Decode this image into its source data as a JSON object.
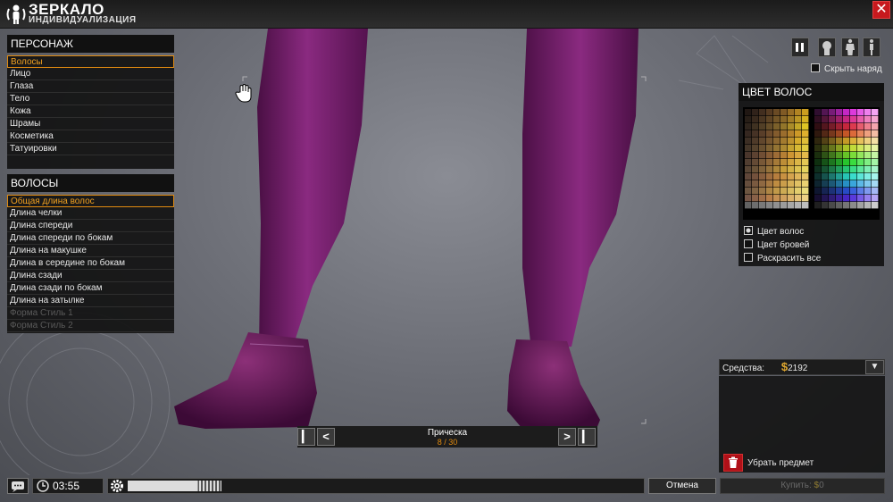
{
  "header": {
    "title": "ЗЕРКАЛО",
    "subtitle": "ИНДИВИДУАЛИЗАЦИЯ",
    "close_icon": "close-icon"
  },
  "character_panel": {
    "title": "ПЕРСОНАЖ",
    "items": [
      {
        "label": "Волосы",
        "selected": true
      },
      {
        "label": "Лицо"
      },
      {
        "label": "Глаза"
      },
      {
        "label": "Тело"
      },
      {
        "label": "Кожа"
      },
      {
        "label": "Шрамы"
      },
      {
        "label": "Косметика"
      },
      {
        "label": "Татуировки"
      }
    ]
  },
  "hair_panel": {
    "title": "ВОЛОСЫ",
    "items": [
      {
        "label": "Общая длина волос",
        "selected": true
      },
      {
        "label": "Длина челки"
      },
      {
        "label": "Длина спереди"
      },
      {
        "label": "Длина спереди по бокам"
      },
      {
        "label": "Длина на макушке"
      },
      {
        "label": "Длина в середине по бокам"
      },
      {
        "label": "Длина сзади"
      },
      {
        "label": "Длина сзади по бокам"
      },
      {
        "label": "Длина на затылке"
      },
      {
        "label": "Форма Стиль 1",
        "disabled": true
      },
      {
        "label": "Форма Стиль 2",
        "disabled": true
      }
    ]
  },
  "view_controls": {
    "icons": [
      "pause-icon",
      "head-view-icon",
      "body-front-view-icon",
      "body-side-view-icon"
    ],
    "hide_outfit_label": "Скрыть наряд",
    "hide_outfit_checked": false
  },
  "color_panel": {
    "title": "ЦВЕТ ВОЛОС",
    "options": [
      {
        "label": "Цвет волос",
        "checked": true
      },
      {
        "label": "Цвет бровей",
        "checked": false
      },
      {
        "label": "Раскрасить все",
        "checked": false
      }
    ]
  },
  "funds": {
    "label": "Средства:",
    "currency_symbol": "$",
    "amount": "2192",
    "remove_item_label": "Убрать предмет"
  },
  "hairstyle_selector": {
    "label": "Прическа",
    "current": "8 / 30"
  },
  "bottom_bar": {
    "chat_icon": "chat-icon",
    "clock_icon": "clock-icon",
    "time": "03:55",
    "settings_icon": "gear-icon",
    "cancel_label": "Отмена",
    "buy_label": "Купить:",
    "buy_price": "0"
  },
  "colors": {
    "accent": "#e08a10",
    "close_red": "#c8191e",
    "trousers": "#6e1a66",
    "shoes": "#5c1450"
  }
}
